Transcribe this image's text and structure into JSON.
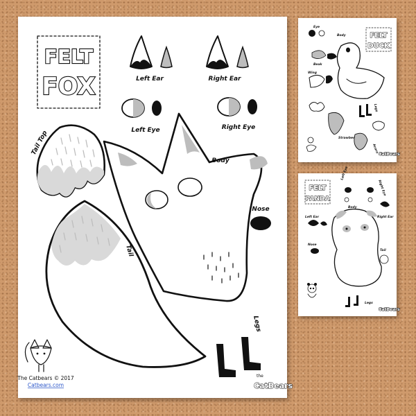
{
  "fox": {
    "title_line1": "FELT",
    "title_line2": "FOX",
    "labels": {
      "left_ear": "Left Ear",
      "right_ear": "Right Ear",
      "left_eye": "Left Eye",
      "right_eye": "Right Eye",
      "tail_top": "Tail Top",
      "body": "Body",
      "nose": "Nose",
      "tail": "Tail",
      "legs": "Legs"
    },
    "copyright": "The Catbears © 2017",
    "website": "Catbears.com",
    "brand_small": "the",
    "brand": "CatBears"
  },
  "duck": {
    "title_line1": "FELT",
    "title_line2": "DUCK",
    "labels": {
      "eye": "Eye",
      "body": "Body",
      "beak": "Beak",
      "wing": "Wing",
      "legs": "Legs",
      "strawberry": "Strawberry",
      "acorn": "Acorn"
    }
  },
  "panda": {
    "title_line1": "FELT",
    "title_line2": "PANDA",
    "labels": {
      "left_eye": "Left Eye",
      "right_eye": "Right Eye",
      "body": "Body",
      "left_ear": "Left Ear",
      "right_ear": "Right Ear",
      "nose": "Nose",
      "tail": "Tail",
      "legs": "Legs"
    }
  },
  "colors": {
    "board": "#cf9a6c",
    "paper": "#ffffff",
    "ink": "#111111",
    "felt_gray": "#bdbdbd",
    "link_blue": "#2b56c9"
  }
}
